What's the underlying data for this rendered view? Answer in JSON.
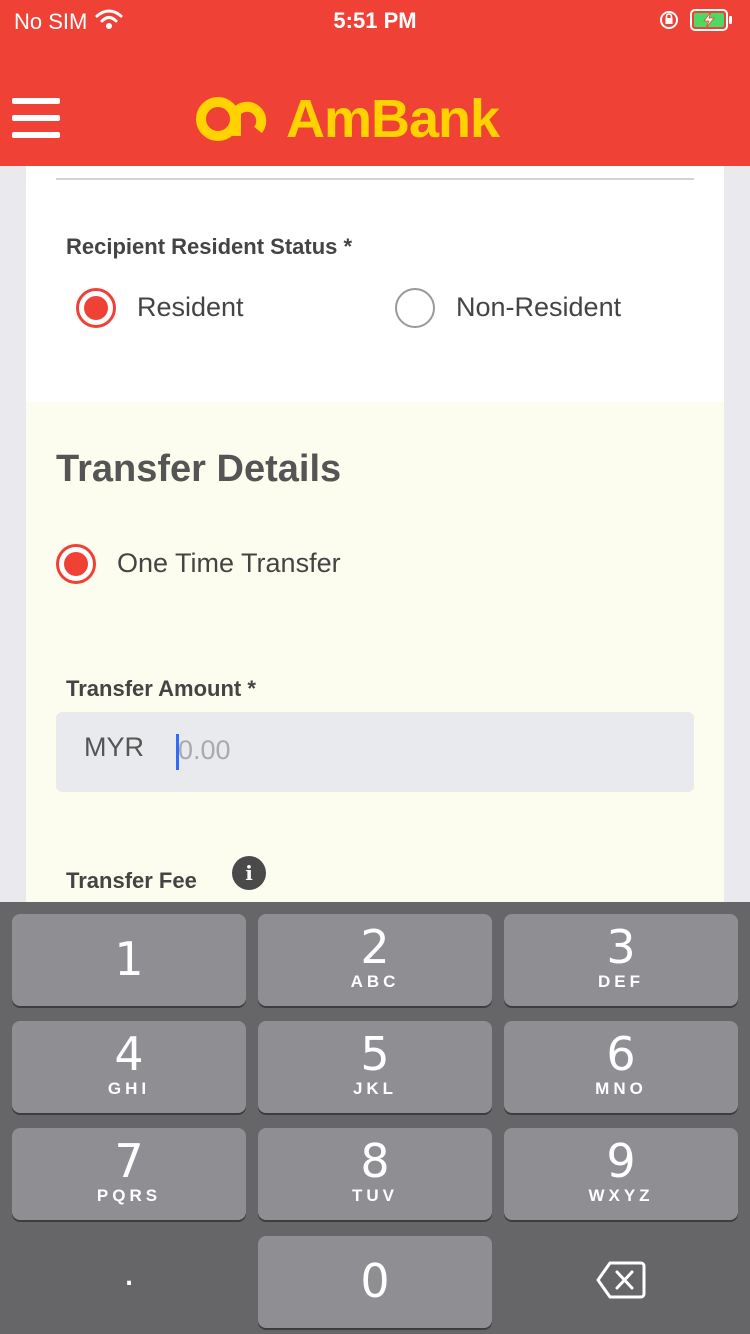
{
  "status_bar": {
    "carrier": "No SIM",
    "time": "5:51 PM"
  },
  "header": {
    "brand": "AmBank"
  },
  "resident_status": {
    "label": "Recipient Resident Status *",
    "options": [
      {
        "label": "Resident",
        "selected": true
      },
      {
        "label": "Non-Resident",
        "selected": false
      }
    ]
  },
  "transfer_details": {
    "title": "Transfer Details",
    "type_option": {
      "label": "One Time Transfer",
      "selected": true
    },
    "amount_label": "Transfer Amount *",
    "currency": "MYR",
    "amount_placeholder": "0.00",
    "fee_label": "Transfer Fee",
    "info_icon": "i"
  },
  "keypad": {
    "keys": [
      {
        "num": "1",
        "letters": ""
      },
      {
        "num": "2",
        "letters": "ABC"
      },
      {
        "num": "3",
        "letters": "DEF"
      },
      {
        "num": "4",
        "letters": "GHI"
      },
      {
        "num": "5",
        "letters": "JKL"
      },
      {
        "num": "6",
        "letters": "MNO"
      },
      {
        "num": "7",
        "letters": "PQRS"
      },
      {
        "num": "8",
        "letters": "TUV"
      },
      {
        "num": "9",
        "letters": "WXYZ"
      },
      {
        "num": "0",
        "letters": ""
      }
    ],
    "decimal": ".",
    "delete_icon": "backspace-icon"
  },
  "colors": {
    "brand_red": "#ef4136",
    "brand_yellow": "#ffd200",
    "cream": "#fdfdef",
    "keypad_bg": "#666668",
    "key_bg": "#8e8e93"
  }
}
